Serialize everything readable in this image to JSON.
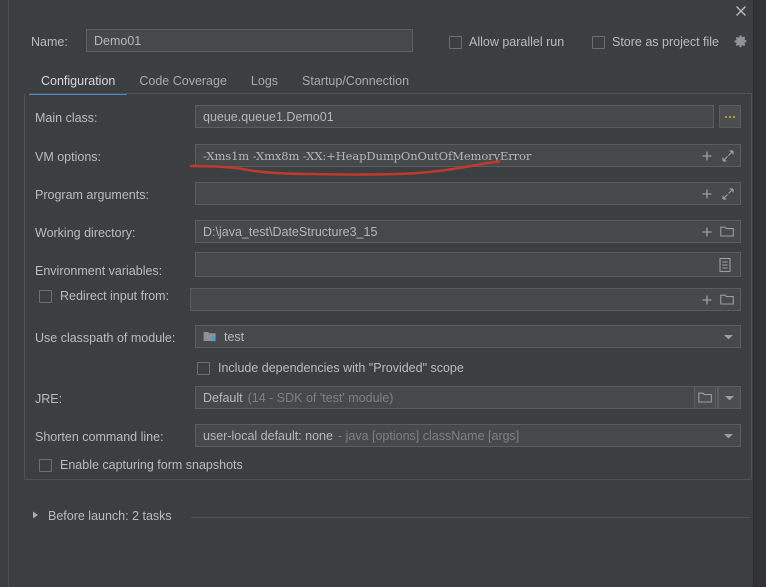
{
  "window": {
    "close_icon": "close-icon"
  },
  "header": {
    "name_label": "Name:",
    "name_value": "Demo01",
    "name_placeholder": "Name",
    "allow_parallel_run": "Allow parallel run",
    "store_as_project_file": "Store as project file",
    "gear_icon": "gear-icon"
  },
  "tabs": [
    {
      "label": "Configuration",
      "active": true
    },
    {
      "label": "Code Coverage",
      "active": false
    },
    {
      "label": "Logs",
      "active": false
    },
    {
      "label": "Startup/Connection",
      "active": false
    }
  ],
  "form": {
    "main_class": {
      "label": "Main class:",
      "value": "queue.queue1.Demo01",
      "browse_label": "..."
    },
    "vm_options": {
      "label": "VM options:",
      "value": "-Xms1m -Xmx8m -XX:+HeapDumpOnOutOfMemoryError",
      "expand_icon": "expand-icon",
      "add_icon": "plus-icon"
    },
    "program_arguments": {
      "label": "Program arguments:",
      "value": "",
      "expand_icon": "expand-icon",
      "add_icon": "plus-icon"
    },
    "working_directory": {
      "label": "Working directory:",
      "value": "D:\\java_test\\DateStructure3_15",
      "browse_icon": "folder-icon",
      "add_icon": "plus-icon"
    },
    "environment_variables": {
      "label": "Environment variables:",
      "value": "",
      "browse_icon": "list-icon"
    },
    "redirect_input": {
      "label": "Redirect input from:",
      "checked": false,
      "value": "",
      "browse_icon": "folder-icon",
      "add_icon": "plus-icon"
    },
    "use_classpath_of_module": {
      "label": "Use classpath of module:",
      "value": "test",
      "module_icon": "module-folder-icon",
      "dropdown_icon": "chevron-down-icon"
    },
    "include_provided": {
      "label": "Include dependencies with \"Provided\" scope",
      "checked": false
    },
    "jre": {
      "label": "JRE:",
      "value": "Default",
      "hint": "(14 - SDK of 'test' module)",
      "browse_icon": "folder-icon",
      "dropdown_icon": "chevron-down-icon"
    },
    "shorten_command_line": {
      "label": "Shorten command line:",
      "value": "user-local default: none",
      "hint": "- java [options] className [args]",
      "dropdown_icon": "chevron-down-icon"
    },
    "enable_form_snapshots": {
      "label": "Enable capturing form snapshots",
      "checked": false
    }
  },
  "before_launch": {
    "label": "Before launch: 2 tasks",
    "expander_icon": "triangle-right-icon",
    "expanded": false
  },
  "annotation": {
    "type": "red-underline",
    "color": "#c0392b",
    "target": "vm_options"
  },
  "colors": {
    "background": "#3c3f41",
    "field_background": "#45494a",
    "border": "#5a5d5e",
    "text": "#bbbbbb",
    "dim_text": "#7c8084",
    "accent": "#4a88c7",
    "annotation_red": "#c0392b"
  }
}
